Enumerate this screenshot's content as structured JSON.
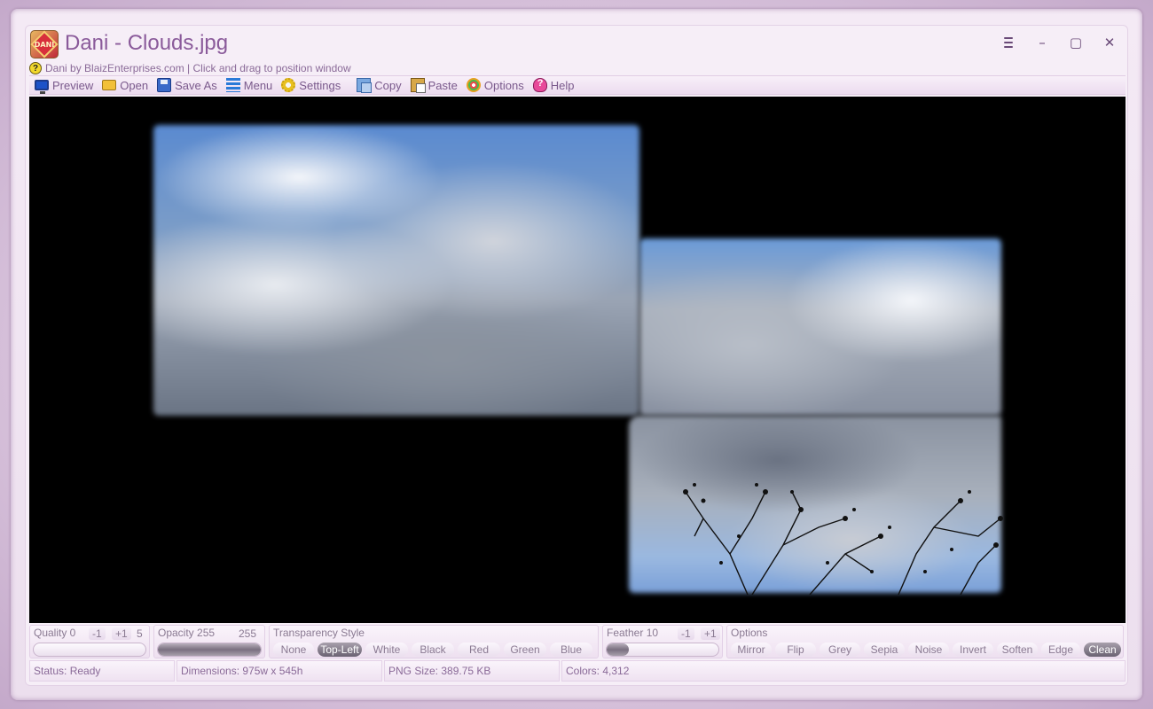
{
  "window": {
    "title": "Dani - Clouds.jpg",
    "logo_text": "DANI",
    "subtitle": "Dani by BlaizEnterprises.com | Click and drag to position window"
  },
  "window_controls": {
    "menu_icon": "hamburger-icon",
    "minimize": "–",
    "maximize": "▢",
    "close": "✕"
  },
  "toolbar": {
    "items": [
      {
        "label": "Preview",
        "icon": "monitor-icon"
      },
      {
        "label": "Open",
        "icon": "folder-icon"
      },
      {
        "label": "Save As",
        "icon": "disk-icon"
      },
      {
        "label": "Menu",
        "icon": "menu-icon"
      },
      {
        "label": "Settings",
        "icon": "gear-icon"
      },
      {
        "label": "Copy",
        "icon": "copy-icon"
      },
      {
        "label": "Paste",
        "icon": "paste-icon"
      },
      {
        "label": "Options",
        "icon": "options-icon"
      },
      {
        "label": "Help",
        "icon": "help-icon"
      }
    ]
  },
  "controls": {
    "quality": {
      "label": "Quality 0",
      "minus": "-1",
      "plus": "+1",
      "value": "5",
      "level": 0
    },
    "opacity": {
      "label": "Opacity 255",
      "value": "255",
      "level": 1.0
    },
    "transparency": {
      "label": "Transparency Style",
      "options": [
        "None",
        "Top-Left",
        "White",
        "Black",
        "Red",
        "Green",
        "Blue"
      ],
      "selected": "Top-Left"
    },
    "feather": {
      "label": "Feather 10",
      "minus": "-1",
      "plus": "+1",
      "level": 0.2
    },
    "options": {
      "label": "Options",
      "items": [
        "Mirror",
        "Flip",
        "Grey",
        "Sepia",
        "Noise",
        "Invert",
        "Soften",
        "Edge",
        "Clean"
      ],
      "selected": "Clean"
    }
  },
  "status": {
    "state": "Status: Ready",
    "dimensions": "Dimensions: 975w x 545h",
    "size": "PNG Size: 389.75 KB",
    "colors": "Colors: 4,312"
  },
  "colors": {
    "accent": "#8a5a9a",
    "canvas_bg": "#000000"
  }
}
